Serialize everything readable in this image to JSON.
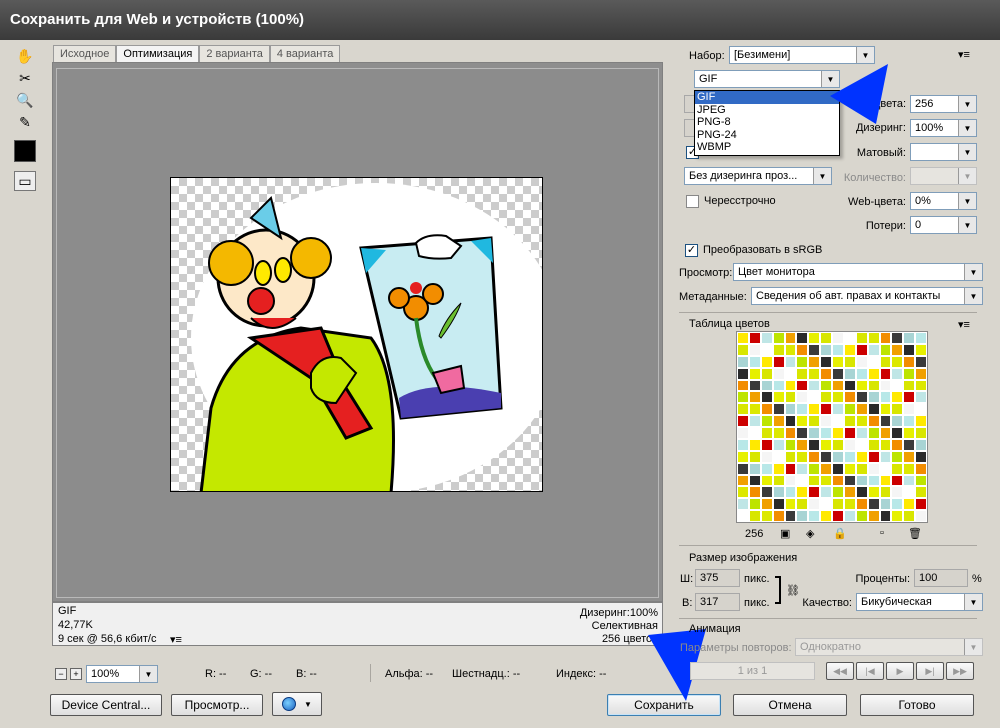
{
  "window": {
    "title": "Сохранить для Web и устройств (100%)"
  },
  "tools": [
    "hand-icon",
    "slice-select-icon",
    "zoom-icon",
    "eyedropper-icon",
    "color-swatch",
    "toggle-slices-icon"
  ],
  "tabs": [
    {
      "label": "Исходное",
      "active": false
    },
    {
      "label": "Оптимизация",
      "active": true
    },
    {
      "label": "2 варианта",
      "active": false
    },
    {
      "label": "4 варианта",
      "active": false
    }
  ],
  "info": {
    "format": "GIF",
    "size": "42,77K",
    "time": "9 сек @ 56,6 кбит/с",
    "dither": "Дизеринг:100%",
    "palette": "Селективная",
    "colors": "256 цветов"
  },
  "status": {
    "zoom": "100%",
    "r": "R: --",
    "g": "G: --",
    "b": "B: --",
    "alpha": "Альфа: --",
    "hex": "Шестнадц.: --",
    "index": "Индекс: --"
  },
  "buttons": {
    "device_central": "Device Central...",
    "preview": "Просмотр...",
    "save": "Сохранить",
    "cancel": "Отмена",
    "done": "Готово"
  },
  "settings": {
    "preset_label": "Набор:",
    "preset_value": "[Безимени]",
    "format_value": "GIF",
    "format_options": [
      "GIF",
      "JPEG",
      "PNG-8",
      "PNG-24",
      "WBMP"
    ],
    "colors_label": "Цвета:",
    "colors_value": "256",
    "dither_label": "Дизеринг:",
    "dither_value": "100%",
    "matte_label": "Матовый:",
    "transparency_dither": "Без дизеринга проз...",
    "amount_label": "Количество:",
    "interlaced_label": "Чересстрочно",
    "web_snap_label": "Web-цвета:",
    "web_snap_value": "0%",
    "lossy_label": "Потери:",
    "lossy_value": "0",
    "convert_srgb_label": "Преобразовать в sRGB",
    "preview_label": "Просмотр:",
    "preview_value": "Цвет монитора",
    "metadata_label": "Метаданные:",
    "metadata_value": "Сведения об авт. правах и контакты"
  },
  "color_table": {
    "title": "Таблица цветов",
    "count": "256",
    "colors": [
      "#ffe900",
      "#d8e600",
      "#a8d4d4",
      "#2a2a2a",
      "#f28d00",
      "#bde400",
      "#d8e600",
      "#cc0000",
      "#f5f5f5",
      "#b8e8e8",
      "#e6f000",
      "#3a3a3a",
      "#f0a000",
      "#dce800",
      "#bfe6e6",
      "#ffffff"
    ]
  },
  "image_size": {
    "title": "Размер изображения",
    "w_label": "Ш:",
    "w_value": "375",
    "h_label": "В:",
    "h_value": "317",
    "unit": "пикс.",
    "percent_label": "Проценты:",
    "percent_value": "100",
    "percent_unit": "%",
    "quality_label": "Качество:",
    "quality_value": "Бикубическая"
  },
  "animation": {
    "title": "Анимация",
    "loop_label": "Параметры повторов:",
    "loop_value": "Однократно",
    "frame": "1 из 1"
  }
}
